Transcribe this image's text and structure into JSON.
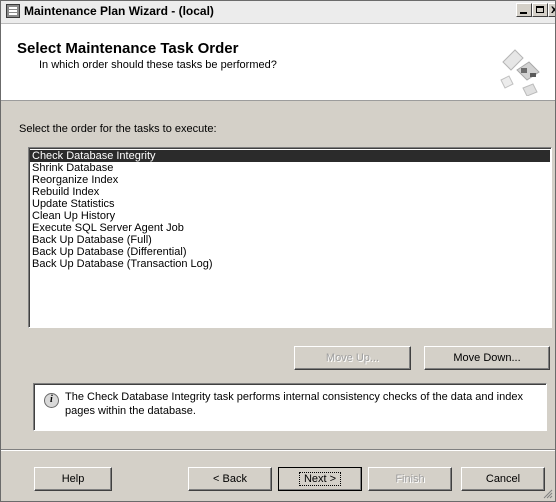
{
  "window": {
    "title": "Maintenance Plan Wizard - (local)",
    "controls": {
      "close_glyph": "x"
    }
  },
  "header": {
    "title": "Select Maintenance Task Order",
    "subtitle": "In which order should these tasks be performed?"
  },
  "task_list": {
    "label": "Select the order for the tasks to execute:",
    "items": [
      "Check Database Integrity",
      "Shrink Database",
      "Reorganize Index",
      "Rebuild Index",
      "Update Statistics",
      "Clean Up History",
      "Execute SQL Server Agent Job",
      "Back Up Database (Full)",
      "Back Up Database (Differential)",
      "Back Up Database (Transaction Log)"
    ],
    "selected_index": 0
  },
  "order_buttons": {
    "move_up": "Move Up...",
    "move_down": "Move Down..."
  },
  "description": {
    "icon": "info-icon",
    "text": "The Check Database Integrity task performs internal consistency checks of the data and index pages within the database."
  },
  "footer": {
    "help": "Help",
    "back": "< Back",
    "next": "Next >",
    "finish": "Finish",
    "cancel": "Cancel"
  },
  "colors": {
    "selection": "#2b2b2b",
    "dialog_bg": "#d4d0c8",
    "header_bg": "#ffffff"
  }
}
